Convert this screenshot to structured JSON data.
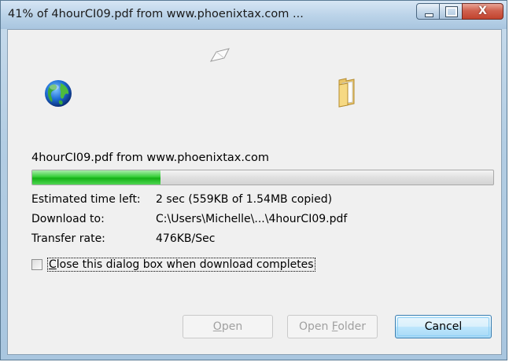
{
  "window": {
    "title": "41% of 4hourCI09.pdf from www.phoenixtax.com ...",
    "close_glyph": "X"
  },
  "icons": {
    "source": "globe-icon",
    "transfer": "paper-icon",
    "destination": "folder-icon"
  },
  "download": {
    "file_line": "4hourCI09.pdf from www.phoenixtax.com",
    "progress_percent": 41,
    "estimated_label": "Estimated time left:",
    "estimated_value": "2 sec (559KB of 1.54MB copied)",
    "download_to_label": "Download to:",
    "download_to_value": "C:\\Users\\Michelle\\...\\4hourCI09.pdf",
    "transfer_rate_label": "Transfer rate:",
    "transfer_rate_value": "476KB/Sec"
  },
  "options": {
    "close_when_done_first": "C",
    "close_when_done_rest": "lose this dialog box when download completes",
    "close_when_done_checked": false
  },
  "buttons": {
    "open_acc": "O",
    "open_rest": "pen",
    "open_folder_prefix": "Open ",
    "open_folder_acc": "F",
    "open_folder_rest": "older",
    "cancel": "Cancel"
  },
  "colors": {
    "progress_green": "#14b116",
    "cancel_border": "#3c7fb1",
    "close_red": "#c2432e"
  }
}
